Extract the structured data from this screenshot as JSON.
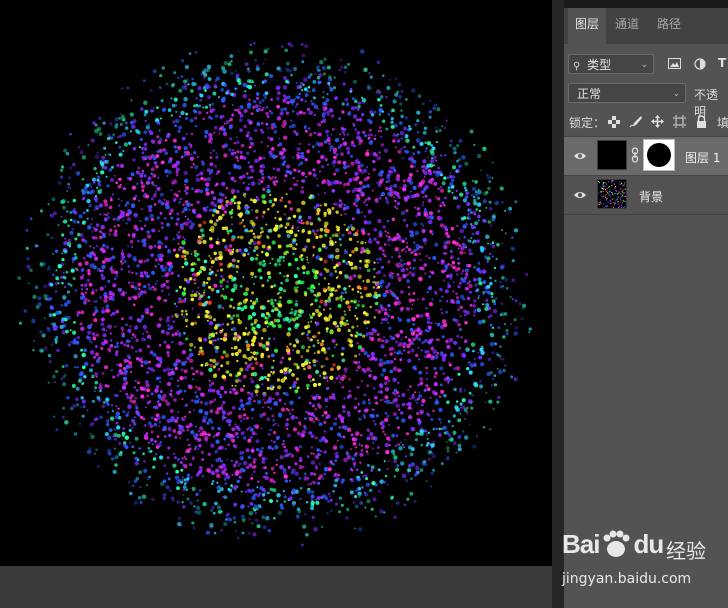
{
  "panel": {
    "tabs": [
      {
        "label": "图层",
        "active": true
      },
      {
        "label": "通道",
        "active": false
      },
      {
        "label": "路径",
        "active": false
      }
    ],
    "filter_kind": "类型",
    "filter_icons": [
      "image-icon",
      "adjustment-circle-icon",
      "type-T-icon"
    ],
    "filter_T": "T",
    "blend_mode": "正常",
    "opacity_label": "不透明",
    "lock_label": "锁定：",
    "lock_icons": [
      "lock-transparent-pixels-icon",
      "lock-image-pixels-icon",
      "lock-position-icon",
      "artboard-icon",
      "lock-all-icon"
    ],
    "fill_label": "填",
    "layers": [
      {
        "name": "图层 1",
        "visible": true,
        "selected": true,
        "has_mask": true
      },
      {
        "name": "背景",
        "visible": true,
        "selected": false,
        "has_mask": false
      }
    ]
  },
  "watermark": {
    "brand": "Bai",
    "brand2": "du",
    "product": "经验",
    "url": "jingyan.baidu.com"
  },
  "colors": {
    "canvas_bg": "#000000",
    "panel_bg": "#535353",
    "particle_palette": [
      "#ff2bd6",
      "#c42bff",
      "#7b2bff",
      "#2b5bff",
      "#2bd6ff",
      "#2bffb0",
      "#2bff4a",
      "#f5f52b",
      "#ff3a2b",
      "#ff8a2b"
    ]
  }
}
